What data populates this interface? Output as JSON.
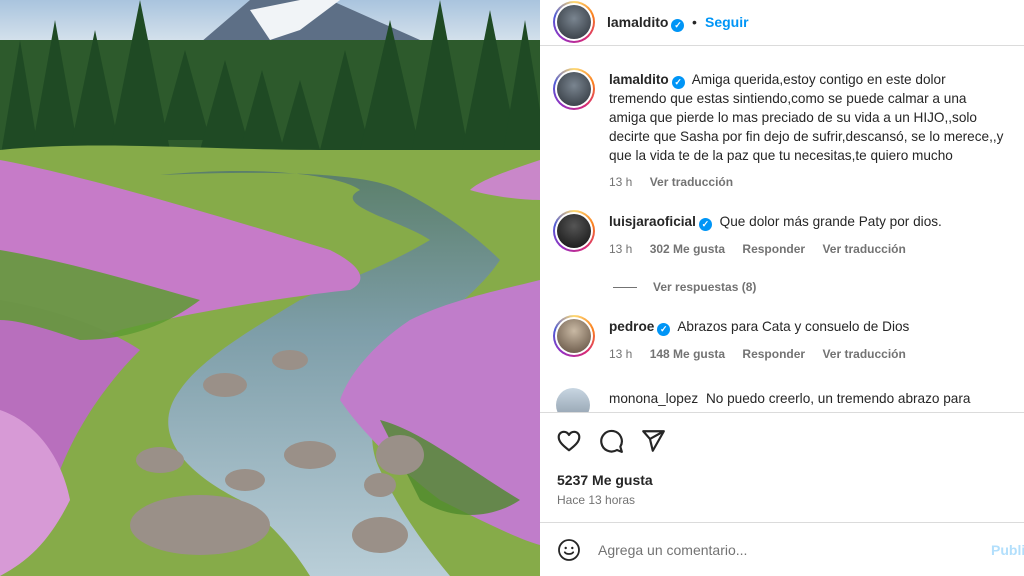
{
  "post": {
    "author": "lamaldito",
    "follow_label": "Seguir",
    "separator": "•",
    "likes_text": "5237 Me gusta",
    "time_text": "Hace 13 horas"
  },
  "comments": [
    {
      "username": "lamaldito",
      "lines": [
        "Amiga querida,estoy contigo en este dolor",
        "tremendo que estas sintiendo,como se puede calmar a una",
        "amiga que pierde lo mas preciado de su vida a un HIJO,,solo",
        "decirte que Sasha por fin dejo de sufrir,descansó, se lo merece,,y",
        "que la vida te de la paz que tu necesitas,te quiero mucho"
      ],
      "time": "13 h",
      "translate": "Ver traducción"
    },
    {
      "username": "luisjaraoficial",
      "text": "Que dolor más grande Paty por dios.",
      "time": "13 h",
      "likes": "302 Me gusta",
      "reply": "Responder",
      "translate": "Ver traducción",
      "view_replies": "Ver respuestas (8)"
    },
    {
      "username": "pedroe",
      "text": "Abrazos para Cata y consuelo de Dios",
      "time": "13 h",
      "likes": "148 Me gusta",
      "reply": "Responder",
      "translate": "Ver traducción"
    },
    {
      "username": "monona_lopez",
      "text": "No puedo creerlo, un tremendo abrazo para"
    }
  ],
  "add_comment": {
    "placeholder": "Agrega un comentario...",
    "publish": "Publicar"
  },
  "icons": [
    "heart-icon",
    "comment-icon",
    "share-icon",
    "emoji-icon",
    "verified-badge-icon"
  ],
  "colors": {
    "accent_blue": "#0095f6",
    "publish_disabled": "#b2dffc",
    "meta_gray": "#737373",
    "divider": "#dbdbdb"
  }
}
